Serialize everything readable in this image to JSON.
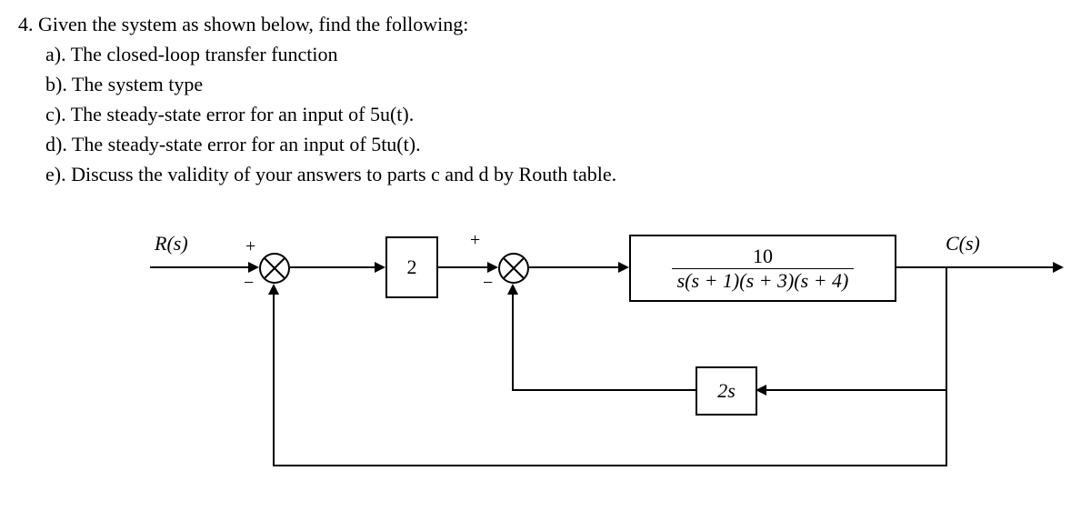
{
  "problem": {
    "number": "4.",
    "stem": "Given the system as shown below, find the following:",
    "parts": {
      "a": "a). The closed-loop transfer function",
      "b": "b). The system type",
      "c": "c). The steady-state error for an input of 5u(t).",
      "d": "d). The steady-state error for an input of 5tu(t).",
      "e": "e). Discuss the validity of your answers to parts c and d by Routh table."
    }
  },
  "diagram": {
    "input_label": "R(s)",
    "output_label": "C(s)",
    "block_gain": "2",
    "plant_numerator": "10",
    "plant_denominator": "s(s + 1)(s + 3)(s + 4)",
    "inner_feedback": "2s",
    "sum1": {
      "top": "+",
      "bottom": "−"
    },
    "sum2": {
      "top": "+",
      "bottom": "−"
    }
  }
}
